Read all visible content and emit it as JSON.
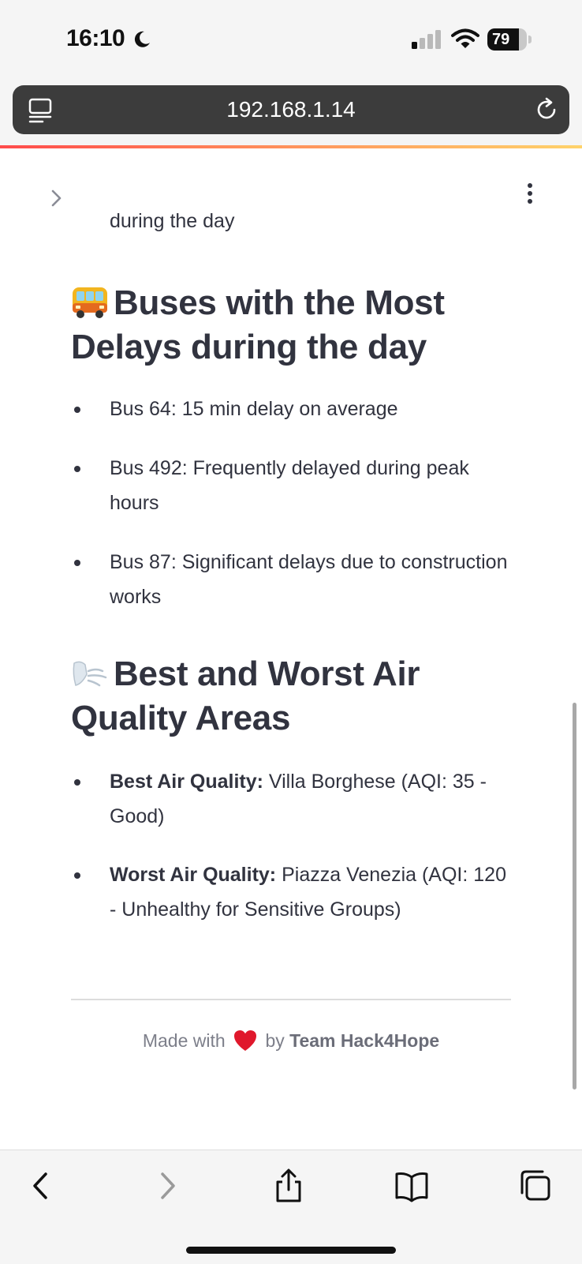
{
  "status_bar": {
    "time": "16:10",
    "battery_level": "79",
    "battery_fraction": 0.79,
    "icons": [
      "moon-icon",
      "cellular-signal-icon",
      "wifi-icon",
      "battery-icon"
    ]
  },
  "browser": {
    "url": "192.168.1.14",
    "icons": [
      "page-menu-icon",
      "reload-icon"
    ],
    "accent_gradient": [
      "#ff4b4b",
      "#ff8c5a",
      "#ffd36b"
    ]
  },
  "page": {
    "previous_text": "during the day",
    "sections": [
      {
        "emoji": "bus-emoji",
        "heading": "Buses with the Most Delays during the day",
        "items": [
          "Bus 64: 15 min delay on average",
          "Bus 492: Frequently delayed during peak hours",
          "Bus 87: Significant delays due to construction works"
        ]
      },
      {
        "emoji": "wind-face-emoji",
        "heading": "Best and Worst Air Quality Areas",
        "items": [
          {
            "label": "Best Air Quality:",
            "text": " Villa Borghese (AQI: 35 - Good)"
          },
          {
            "label": "Worst Air Quality:",
            "text": " Piazza Venezia (AQI: 120 - Unhealthy for Sensitive Groups)"
          }
        ]
      }
    ],
    "footer": {
      "prefix": "Made with",
      "heart": "heart-emoji",
      "by": "by",
      "team": "Team Hack4Hope"
    }
  },
  "toolbar": {
    "icons": [
      "back-arrow-icon",
      "forward-arrow-icon",
      "share-icon",
      "bookmarks-icon",
      "tabs-icon"
    ]
  },
  "colors": {
    "text": "#31333f",
    "muted": "#7d7f8a",
    "chrome_background": "#f5f5f5",
    "address_bar": "#3c3c3c",
    "heart": "#e0182c"
  }
}
